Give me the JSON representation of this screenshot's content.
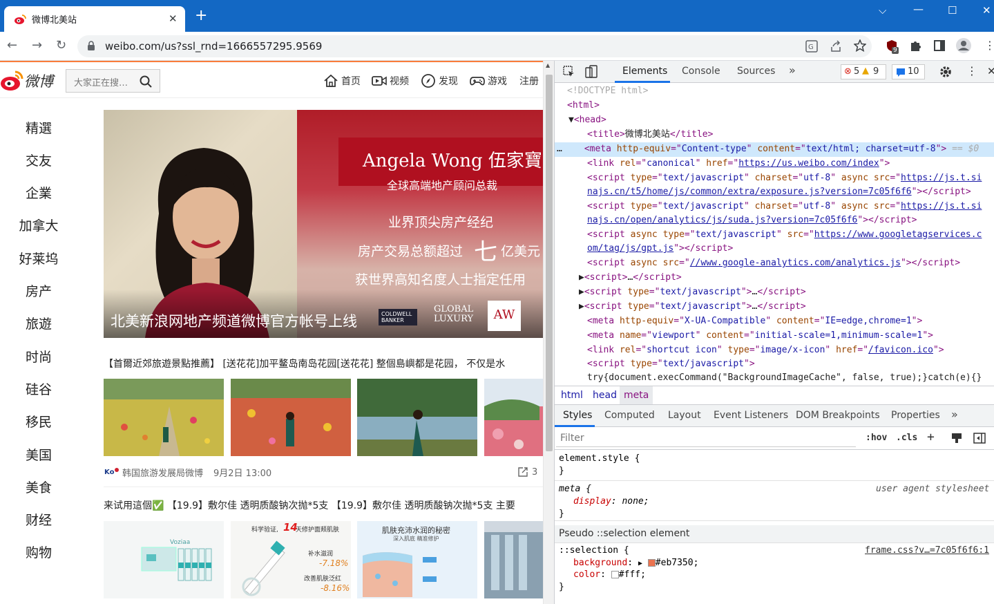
{
  "browser": {
    "tab_title": "微博北美站",
    "new_tab": "+",
    "url": "weibo.com/us?ssl_rnd=1666557295.9569",
    "window_controls": [
      "chevron-down",
      "minimize",
      "maximize",
      "close"
    ],
    "ext_badge": "9"
  },
  "weibo": {
    "logo_text": "微博",
    "search_placeholder": "大家正在搜…",
    "nav": [
      {
        "label": "首页",
        "icon": "home-icon"
      },
      {
        "label": "视频",
        "icon": "video-icon"
      },
      {
        "label": "发现",
        "icon": "compass-icon"
      },
      {
        "label": "游戏",
        "icon": "gamepad-icon"
      },
      {
        "label": "注册",
        "icon": ""
      }
    ],
    "sidebar": [
      "精選",
      "交友",
      "企業",
      "加拿大",
      "好莱坞",
      "房产",
      "旅遊",
      "时尚",
      "硅谷",
      "移民",
      "美国",
      "美食",
      "财经",
      "购物"
    ],
    "banner": {
      "name": "Angela Wong 伍家寶",
      "subtitle": "全球高端地产顾问总裁",
      "line1": "业界顶尖房产经纪",
      "line2a": "房产交易总额超过",
      "line2b": "七",
      "line2c": "亿美元",
      "line3": "获世界高知名度人士指定任用",
      "caption": "北美新浪网地产频道微博官方帐号上线",
      "logo1": "COLDWELL BANKER",
      "logo2": "GLOBAL LUXURY",
      "logo3": "AW"
    },
    "post1": {
      "text": "【首爾近郊旅遊景點推薦】 [送花花]加平鳌岛南岛花园[送花花] 整個島嶼都是花园， 不仅是水",
      "author": "韩国旅游发展局微博",
      "time": "9月2日 13:00",
      "shares": "3"
    },
    "post2": {
      "text": "来试用這個✅ 【19.9】敷尔佳 透明质酸钠次抛*5支 【19.9】敷尔佳 透明质酸钠次抛*5支 主要",
      "thumb2_a": "科学验证,",
      "thumb2_b": "14",
      "thumb2_c": "天修护面颊肌肤",
      "thumb2_d": "补水滋润",
      "thumb2_e": "-7.18%",
      "thumb2_f": "改善肌肤泛红",
      "thumb2_g": "-8.16%",
      "thumb3_title": "肌肤充沛水润的秘密",
      "thumb3_sub": "深入肌底 精准修护",
      "thumb1_brand": "Voziaa"
    }
  },
  "devtools": {
    "tabs": [
      "Elements",
      "Console",
      "Sources"
    ],
    "more": "»",
    "errors": "5",
    "warnings": "9",
    "messages": "10",
    "breadcrumb": [
      "html",
      "head",
      "meta"
    ],
    "style_tabs": [
      "Styles",
      "Computed",
      "Layout",
      "Event Listeners",
      "DOM Breakpoints",
      "Properties"
    ],
    "filter_placeholder": "Filter",
    "hov": ":hov",
    "cls": ".cls",
    "element_style": "element.style {",
    "close_brace": "}",
    "meta_selector": "meta {",
    "ua_label": "user agent stylesheet",
    "display_prop": "display",
    "display_val": "none;",
    "pseudo_header": "Pseudo ::selection element",
    "selection_selector": "::selection {",
    "frame_link": "frame.css?v…=7c05f6f6:1",
    "bg_prop": "background",
    "bg_val": "#eb7350;",
    "bg_color": "#eb7350",
    "color_prop": "color",
    "color_val": "#fff;",
    "selected_marker": "== $0"
  }
}
